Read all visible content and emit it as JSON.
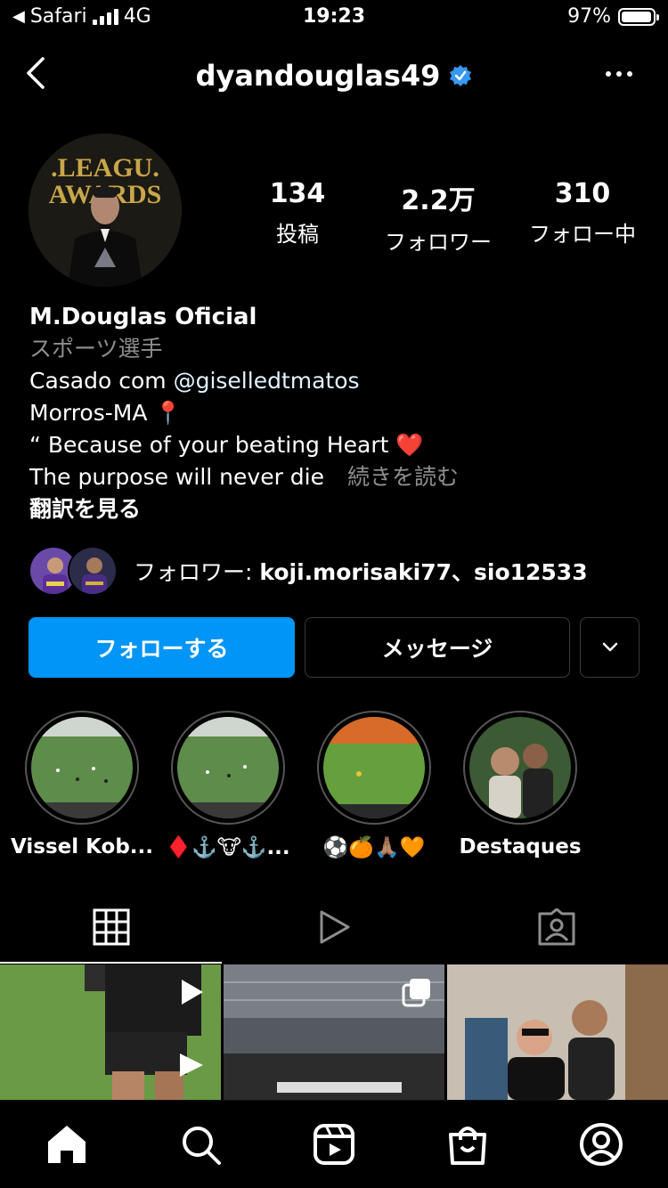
{
  "status": {
    "carrier": "Safari",
    "network": "4G",
    "time": "19:23",
    "battery": "97%",
    "battery_level": 0.97
  },
  "header": {
    "username": "dyandouglas49"
  },
  "stats": [
    {
      "num": "134",
      "label": "投稿"
    },
    {
      "num": "2.2万",
      "label": "フォロワー"
    },
    {
      "num": "310",
      "label": "フォロー中"
    }
  ],
  "bio": {
    "name": "M.Douglas Oficial",
    "category": "スポーツ選手",
    "line1_prefix": "Casado com ",
    "mention": "@giselledtmatos",
    "line2": "Morros-MA 📍",
    "line3": "“ Because of your beating Heart ❤️",
    "line4": "The purpose will never die",
    "more": "続きを読む",
    "translate": "翻訳を見る"
  },
  "followed_by": {
    "prefix": "フォロワー: ",
    "users": "koji.morisaki77、sio12533"
  },
  "buttons": {
    "follow": "フォローする",
    "message": "メッセージ"
  },
  "highlights": [
    {
      "label": "Vissel Kob..."
    },
    {
      "label": "♦️⚓️🐮⚓️..."
    },
    {
      "label": "⚽️🍊🙏🏽🧡"
    },
    {
      "label": "Destaques"
    }
  ],
  "colors": {
    "accent": "#0095f6",
    "verified": "#3897f0",
    "background": "#000000"
  },
  "icons": [
    "back-icon",
    "verified-icon",
    "more-icon",
    "chevron-down-icon",
    "grid-icon",
    "reels-icon",
    "tagged-icon",
    "home-icon",
    "search-icon",
    "reels-nav-icon",
    "shop-icon",
    "profile-icon"
  ]
}
